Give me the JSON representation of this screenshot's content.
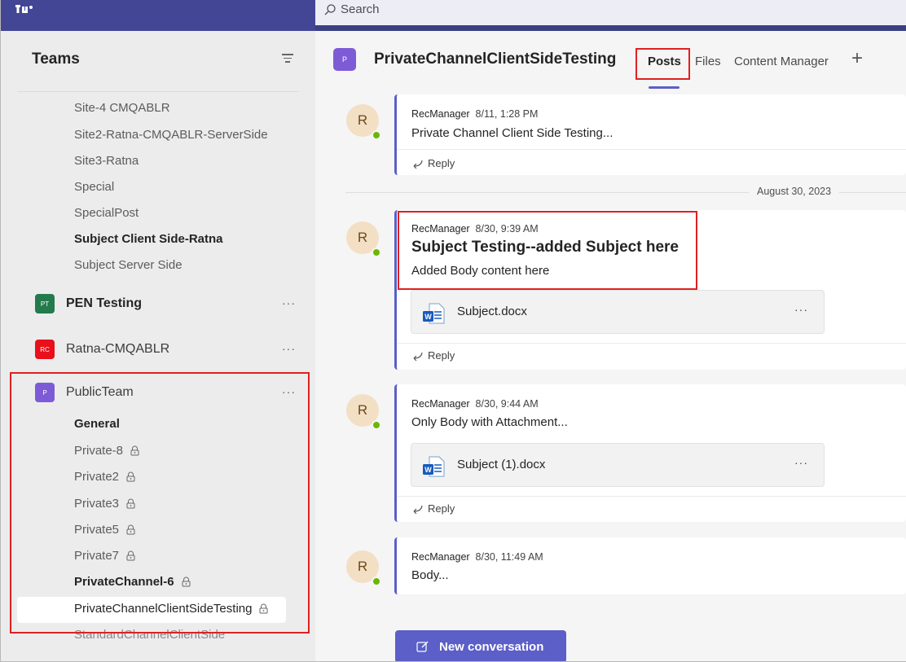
{
  "app": {
    "search_placeholder": "Search"
  },
  "sidebar": {
    "title": "Teams",
    "channels_top": [
      {
        "label": "Site-4 CMQABLR",
        "bold": false
      },
      {
        "label": "Site2-Ratna-CMQABLR-ServerSide",
        "bold": false
      },
      {
        "label": "Site3-Ratna",
        "bold": false
      },
      {
        "label": "Special",
        "bold": false
      },
      {
        "label": "SpecialPost",
        "bold": false
      },
      {
        "label": "Subject Client Side-Ratna",
        "bold": true
      },
      {
        "label": "Subject Server Side",
        "bold": false
      }
    ],
    "teams": [
      {
        "initials": "PT",
        "name": "PEN Testing",
        "color": "#237b4b",
        "bold": true
      },
      {
        "initials": "RC",
        "name": "Ratna-CMQABLR",
        "color": "#e8101a",
        "bold": false
      },
      {
        "initials": "P",
        "name": "PublicTeam",
        "color": "#7e5bd6",
        "bold": false
      }
    ],
    "public_team_channels": [
      {
        "label": "General",
        "bold": true,
        "private": false
      },
      {
        "label": "Private-8",
        "bold": false,
        "private": true
      },
      {
        "label": "Private2",
        "bold": false,
        "private": true
      },
      {
        "label": "Private3",
        "bold": false,
        "private": true
      },
      {
        "label": "Private5",
        "bold": false,
        "private": true
      },
      {
        "label": "Private7",
        "bold": false,
        "private": true
      },
      {
        "label": "PrivateChannel-6",
        "bold": true,
        "private": true
      },
      {
        "label": "PrivateChannelClientSideTesting",
        "bold": false,
        "private": true,
        "selected": true
      },
      {
        "label": "StandardChannelClientSide",
        "bold": false,
        "private": false
      }
    ],
    "more_label": "···"
  },
  "channel": {
    "avatar_initial": "P",
    "title": "PrivateChannelClientSideTesting",
    "tabs": [
      {
        "label": "Posts",
        "active": true
      },
      {
        "label": "Files",
        "active": false
      },
      {
        "label": "Content Manager",
        "active": false
      }
    ],
    "add_tab": "+"
  },
  "posts": [
    {
      "avatar": "R",
      "author": "RecManager",
      "time": "8/11, 1:28 PM",
      "body": "Private Channel Client Side Testing...",
      "reply": "Reply"
    },
    {
      "avatar": "R",
      "author": "RecManager",
      "time": "8/30, 9:39 AM",
      "subject": "Subject Testing--added Subject here",
      "body": "Added Body content here",
      "attachment": "Subject.docx",
      "reply": "Reply"
    },
    {
      "avatar": "R",
      "author": "RecManager",
      "time": "8/30, 9:44 AM",
      "body": "Only Body with Attachment...",
      "attachment": "Subject (1).docx",
      "reply": "Reply"
    },
    {
      "avatar": "R",
      "author": "RecManager",
      "time": "8/30, 11:49 AM",
      "body": "Body..."
    }
  ],
  "date_separator": "August 30, 2023",
  "new_conversation_label": "New conversation",
  "word_badge": "W",
  "colors": {
    "accent": "#5b5fc7",
    "highlight": "#e02020",
    "presence": "#6bb700"
  }
}
